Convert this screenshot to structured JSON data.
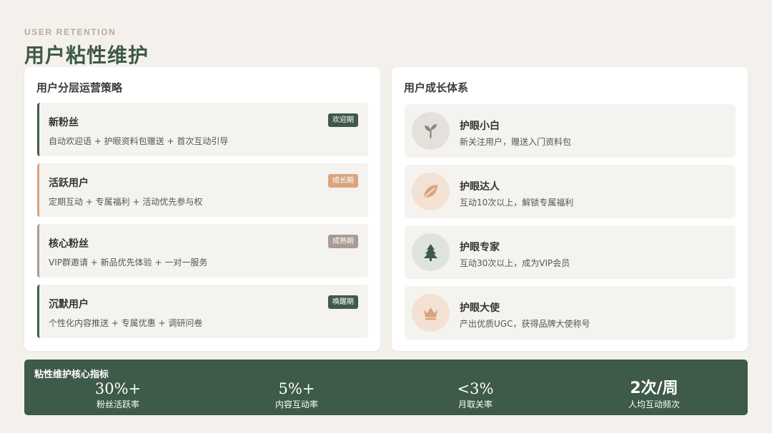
{
  "header": {
    "eyebrow": "USER RETENTION",
    "title": "用户粘性维护"
  },
  "left_card": {
    "title": "用户分层运营策略",
    "tiers": [
      {
        "name": "新粉丝",
        "desc": "自动欢迎语 + 护眼资料包赠送 + 首次互动引导",
        "badge": "欢迎期",
        "accent": "#3e5a48",
        "badge_color": "#3e5a48"
      },
      {
        "name": "活跃用户",
        "desc": "定期互动 + 专属福利 + 活动优先参与权",
        "badge": "成长期",
        "accent": "#d9a47e",
        "badge_color": "#d9a47e"
      },
      {
        "name": "核心粉丝",
        "desc": "VIP群邀请 + 新品优先体验 + 一对一服务",
        "badge": "成熟期",
        "accent": "#a89b92",
        "badge_color": "#a89b92"
      },
      {
        "name": "沉默用户",
        "desc": "个性化内容推送 + 专属优惠 + 调研问卷",
        "badge": "唤醒期",
        "accent": "#3e5a48",
        "badge_color": "#3e5a48"
      }
    ]
  },
  "right_card": {
    "title": "用户成长体系",
    "levels": [
      {
        "name": "护眼小白",
        "desc": "新关注用户，赠送入门资料包",
        "icon": "sprout-icon",
        "icon_bg": "#e4e1dc",
        "icon_color": "#8b857c"
      },
      {
        "name": "护眼达人",
        "desc": "互动10次以上，解锁专属福利",
        "icon": "leaf-icon",
        "icon_bg": "#f3e2d3",
        "icon_color": "#d9a47e"
      },
      {
        "name": "护眼专家",
        "desc": "互动30次以上，成为VIP会员",
        "icon": "tree-icon",
        "icon_bg": "#dfe3de",
        "icon_color": "#3e5a48"
      },
      {
        "name": "护眼大使",
        "desc": "产出优质UGC，获得品牌大使称号",
        "icon": "crown-icon",
        "icon_bg": "#f3e2d3",
        "icon_color": "#d9a47e"
      }
    ]
  },
  "metrics": {
    "title": "粘性维护核心指标",
    "items": [
      {
        "value": "30%+",
        "label": "粉丝活跃率"
      },
      {
        "value": "5%+",
        "label": "内容互动率"
      },
      {
        "value": "<3%",
        "label": "月取关率"
      },
      {
        "value": "2次/周",
        "label": "人均互动频次"
      }
    ]
  },
  "colors": {
    "primary": "#3e5a48",
    "accent": "#d9a47e",
    "muted": "#a89b92",
    "background": "#f4f1ec"
  }
}
